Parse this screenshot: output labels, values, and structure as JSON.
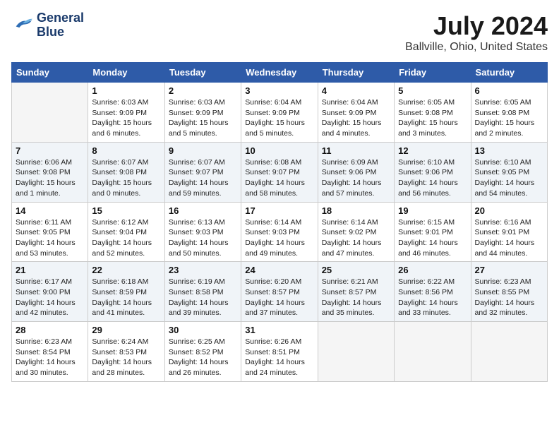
{
  "header": {
    "logo_line1": "General",
    "logo_line2": "Blue",
    "month_title": "July 2024",
    "location": "Ballville, Ohio, United States"
  },
  "weekdays": [
    "Sunday",
    "Monday",
    "Tuesday",
    "Wednesday",
    "Thursday",
    "Friday",
    "Saturday"
  ],
  "weeks": [
    [
      {
        "day": null
      },
      {
        "day": "1",
        "sunrise": "6:03 AM",
        "sunset": "9:09 PM",
        "daylight": "15 hours and 6 minutes."
      },
      {
        "day": "2",
        "sunrise": "6:03 AM",
        "sunset": "9:09 PM",
        "daylight": "15 hours and 5 minutes."
      },
      {
        "day": "3",
        "sunrise": "6:04 AM",
        "sunset": "9:09 PM",
        "daylight": "15 hours and 5 minutes."
      },
      {
        "day": "4",
        "sunrise": "6:04 AM",
        "sunset": "9:09 PM",
        "daylight": "15 hours and 4 minutes."
      },
      {
        "day": "5",
        "sunrise": "6:05 AM",
        "sunset": "9:08 PM",
        "daylight": "15 hours and 3 minutes."
      },
      {
        "day": "6",
        "sunrise": "6:05 AM",
        "sunset": "9:08 PM",
        "daylight": "15 hours and 2 minutes."
      }
    ],
    [
      {
        "day": "7",
        "sunrise": "6:06 AM",
        "sunset": "9:08 PM",
        "daylight": "15 hours and 1 minute."
      },
      {
        "day": "8",
        "sunrise": "6:07 AM",
        "sunset": "9:08 PM",
        "daylight": "15 hours and 0 minutes."
      },
      {
        "day": "9",
        "sunrise": "6:07 AM",
        "sunset": "9:07 PM",
        "daylight": "14 hours and 59 minutes."
      },
      {
        "day": "10",
        "sunrise": "6:08 AM",
        "sunset": "9:07 PM",
        "daylight": "14 hours and 58 minutes."
      },
      {
        "day": "11",
        "sunrise": "6:09 AM",
        "sunset": "9:06 PM",
        "daylight": "14 hours and 57 minutes."
      },
      {
        "day": "12",
        "sunrise": "6:10 AM",
        "sunset": "9:06 PM",
        "daylight": "14 hours and 56 minutes."
      },
      {
        "day": "13",
        "sunrise": "6:10 AM",
        "sunset": "9:05 PM",
        "daylight": "14 hours and 54 minutes."
      }
    ],
    [
      {
        "day": "14",
        "sunrise": "6:11 AM",
        "sunset": "9:05 PM",
        "daylight": "14 hours and 53 minutes."
      },
      {
        "day": "15",
        "sunrise": "6:12 AM",
        "sunset": "9:04 PM",
        "daylight": "14 hours and 52 minutes."
      },
      {
        "day": "16",
        "sunrise": "6:13 AM",
        "sunset": "9:03 PM",
        "daylight": "14 hours and 50 minutes."
      },
      {
        "day": "17",
        "sunrise": "6:14 AM",
        "sunset": "9:03 PM",
        "daylight": "14 hours and 49 minutes."
      },
      {
        "day": "18",
        "sunrise": "6:14 AM",
        "sunset": "9:02 PM",
        "daylight": "14 hours and 47 minutes."
      },
      {
        "day": "19",
        "sunrise": "6:15 AM",
        "sunset": "9:01 PM",
        "daylight": "14 hours and 46 minutes."
      },
      {
        "day": "20",
        "sunrise": "6:16 AM",
        "sunset": "9:01 PM",
        "daylight": "14 hours and 44 minutes."
      }
    ],
    [
      {
        "day": "21",
        "sunrise": "6:17 AM",
        "sunset": "9:00 PM",
        "daylight": "14 hours and 42 minutes."
      },
      {
        "day": "22",
        "sunrise": "6:18 AM",
        "sunset": "8:59 PM",
        "daylight": "14 hours and 41 minutes."
      },
      {
        "day": "23",
        "sunrise": "6:19 AM",
        "sunset": "8:58 PM",
        "daylight": "14 hours and 39 minutes."
      },
      {
        "day": "24",
        "sunrise": "6:20 AM",
        "sunset": "8:57 PM",
        "daylight": "14 hours and 37 minutes."
      },
      {
        "day": "25",
        "sunrise": "6:21 AM",
        "sunset": "8:57 PM",
        "daylight": "14 hours and 35 minutes."
      },
      {
        "day": "26",
        "sunrise": "6:22 AM",
        "sunset": "8:56 PM",
        "daylight": "14 hours and 33 minutes."
      },
      {
        "day": "27",
        "sunrise": "6:23 AM",
        "sunset": "8:55 PM",
        "daylight": "14 hours and 32 minutes."
      }
    ],
    [
      {
        "day": "28",
        "sunrise": "6:23 AM",
        "sunset": "8:54 PM",
        "daylight": "14 hours and 30 minutes."
      },
      {
        "day": "29",
        "sunrise": "6:24 AM",
        "sunset": "8:53 PM",
        "daylight": "14 hours and 28 minutes."
      },
      {
        "day": "30",
        "sunrise": "6:25 AM",
        "sunset": "8:52 PM",
        "daylight": "14 hours and 26 minutes."
      },
      {
        "day": "31",
        "sunrise": "6:26 AM",
        "sunset": "8:51 PM",
        "daylight": "14 hours and 24 minutes."
      },
      {
        "day": null
      },
      {
        "day": null
      },
      {
        "day": null
      }
    ]
  ],
  "labels": {
    "sunrise": "Sunrise:",
    "sunset": "Sunset:",
    "daylight": "Daylight:"
  }
}
